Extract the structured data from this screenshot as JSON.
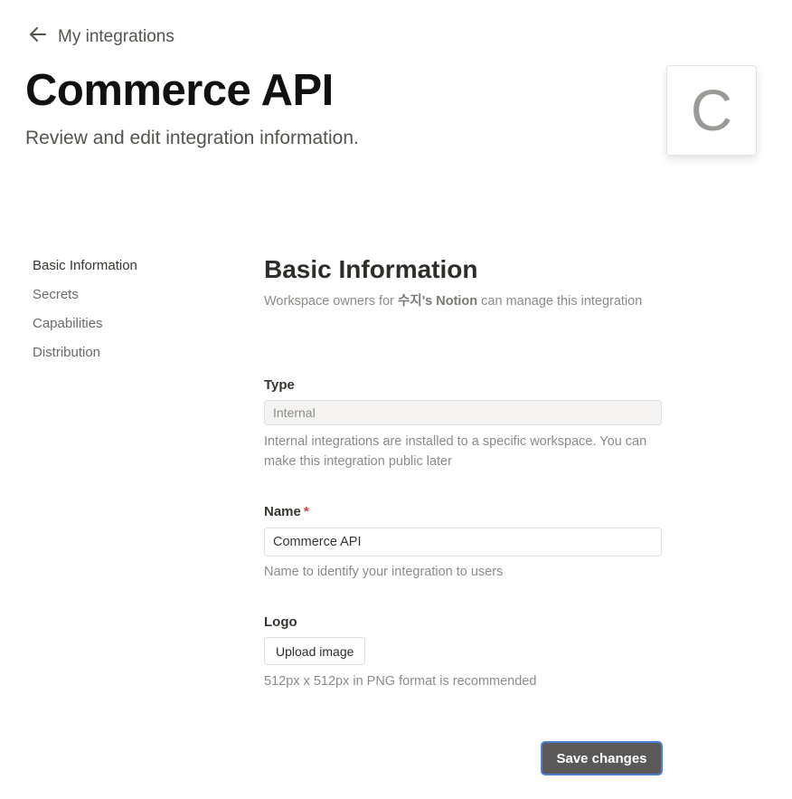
{
  "header": {
    "back_label": "My integrations",
    "title": "Commerce API",
    "subtitle": "Review and edit integration information.",
    "logo_letter": "C"
  },
  "sidebar": {
    "items": [
      {
        "label": "Basic Information",
        "active": true
      },
      {
        "label": "Secrets",
        "active": false
      },
      {
        "label": "Capabilities",
        "active": false
      },
      {
        "label": "Distribution",
        "active": false
      }
    ]
  },
  "basic": {
    "title": "Basic Information",
    "desc_prefix": "Workspace owners for ",
    "desc_workspace": "수지's Notion",
    "desc_suffix": " can manage this integration"
  },
  "type_field": {
    "label": "Type",
    "value": "Internal",
    "hint": "Internal integrations are installed to a specific workspace. You can make this integration public later"
  },
  "name_field": {
    "label": "Name",
    "required_mark": "*",
    "value": "Commerce API",
    "hint": "Name to identify your integration to users"
  },
  "logo_field": {
    "label": "Logo",
    "upload_label": "Upload image",
    "hint": "512px x 512px in PNG format is recommended"
  },
  "actions": {
    "save_label": "Save changes"
  },
  "colors": {
    "save_button": "#5a5958",
    "focus_ring": "#4a7fd6",
    "required": "#e03e3e"
  }
}
